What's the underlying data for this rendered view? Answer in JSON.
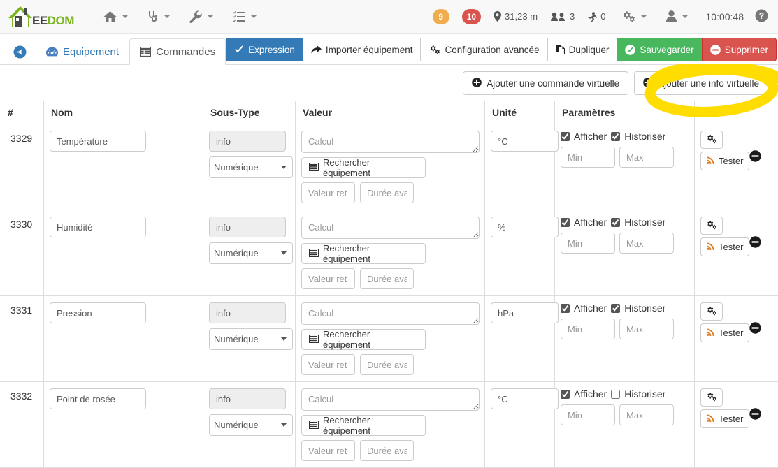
{
  "topnav": {
    "logo_text_dark": "EE",
    "logo_text_green": "DOM",
    "logo_icon": "house-logo-icon",
    "items": [
      {
        "icon": "home-icon",
        "label": ""
      },
      {
        "icon": "stethoscope-icon",
        "label": ""
      },
      {
        "icon": "wrench-icon",
        "label": ""
      },
      {
        "icon": "list-icon",
        "label": ""
      }
    ],
    "badge_warning": "9",
    "badge_danger": "10",
    "location_value": "31,23 m",
    "people_value": "3",
    "away_value": "0",
    "clock": "10:00:48",
    "gear_icon": "cogs-icon",
    "user_icon": "user-icon",
    "help_icon": "help-circle-icon"
  },
  "tabbar": {
    "back_icon": "arrow-circle-left-icon",
    "tabs": [
      {
        "label": "Equipement",
        "icon": "tachometer-icon",
        "active": false
      },
      {
        "label": "Commandes",
        "icon": "table-icon",
        "active": true
      }
    ],
    "actions": [
      {
        "label": "Expression",
        "icon": "check-icon",
        "style": "primary"
      },
      {
        "label": "Importer équipement",
        "icon": "share-icon",
        "style": "default"
      },
      {
        "label": "Configuration avancée",
        "icon": "cogs-icon",
        "style": "default"
      },
      {
        "label": "Dupliquer",
        "icon": "copy-icon",
        "style": "default"
      },
      {
        "label": "Sauvegarder",
        "icon": "check-circle-icon",
        "style": "success"
      },
      {
        "label": "Supprimer",
        "icon": "minus-circle-icon",
        "style": "danger"
      }
    ]
  },
  "add_buttons": [
    {
      "label": "Ajouter une commande virtuelle",
      "icon": "plus-circle-icon"
    },
    {
      "label": "Ajouter une info virtuelle",
      "icon": "plus-circle-icon"
    }
  ],
  "table": {
    "headers": [
      "#",
      "Nom",
      "Sous-Type",
      "Valeur",
      "Unité",
      "Paramètres",
      ""
    ],
    "placeholders": {
      "calcul": "Calcul",
      "valeur_ret": "Valeur ret",
      "duree_ava": "Durée ava",
      "min": "Min",
      "max": "Max"
    },
    "labels": {
      "search_equipment": "Rechercher équipement",
      "afficher": "Afficher",
      "historiser": "Historiser",
      "tester": "Tester",
      "gear_icon": "cogs-icon",
      "test_icon": "rss-icon",
      "delete_icon": "minus-circle-icon",
      "search_icon": "list-alt-icon"
    },
    "rows": [
      {
        "id": "3329",
        "nom": "Température",
        "type": "info",
        "soustype": "Numérique",
        "calcul": "",
        "valeur_ret": "",
        "duree_ava": "",
        "unite": "°C",
        "afficher": true,
        "historiser": true,
        "min": "",
        "max": ""
      },
      {
        "id": "3330",
        "nom": "Humidité",
        "type": "info",
        "soustype": "Numérique",
        "calcul": "",
        "valeur_ret": "",
        "duree_ava": "",
        "unite": "%",
        "afficher": true,
        "historiser": true,
        "min": "",
        "max": ""
      },
      {
        "id": "3331",
        "nom": "Pression",
        "type": "info",
        "soustype": "Numérique",
        "calcul": "",
        "valeur_ret": "",
        "duree_ava": "",
        "unite": "hPa",
        "afficher": true,
        "historiser": true,
        "min": "",
        "max": ""
      },
      {
        "id": "3332",
        "nom": "Point de rosée",
        "type": "info",
        "soustype": "Numérique",
        "calcul": "",
        "valeur_ret": "",
        "duree_ava": "",
        "unite": "°C",
        "afficher": true,
        "historiser": false,
        "min": "",
        "max": ""
      }
    ]
  },
  "annotation": {
    "shape": "ellipse-highlight",
    "color": "#ffdd00",
    "target": "Ajouter une info virtuelle"
  },
  "colors": {
    "primary": "#337ab7",
    "success": "#49b75d",
    "danger": "#d9534f",
    "warning": "#f0ad4e",
    "brand_green": "#7ab51d",
    "highlight": "#ffdd00"
  }
}
